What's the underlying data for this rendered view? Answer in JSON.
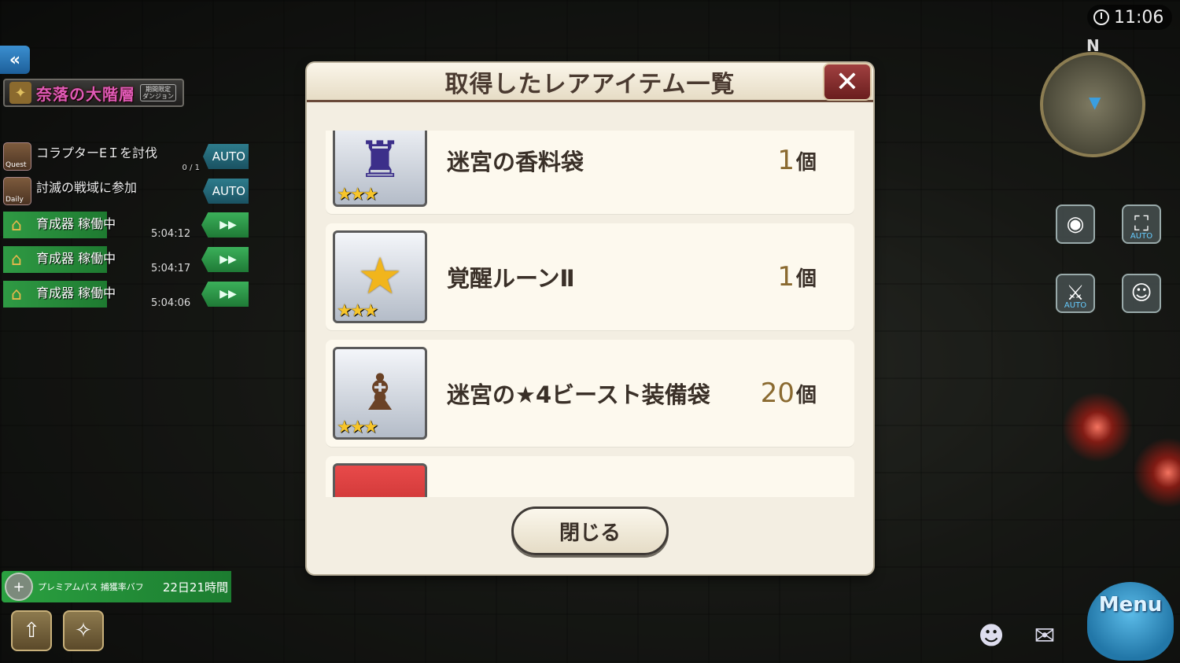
{
  "hud": {
    "clock": "11:06",
    "compass": "N",
    "dungeon": {
      "name": "奈落の大階層",
      "badge_line1": "期間限定",
      "badge_line2": "ダンジョン"
    },
    "quests": [
      {
        "tag": "Quest",
        "text": "コラプターEＩを討伐",
        "progress": "0 / 1",
        "button": "AUTO"
      },
      {
        "tag": "Daily",
        "text": "討滅の戦域に参加",
        "progress": "",
        "button": "AUTO"
      }
    ],
    "incubators": [
      {
        "label": "育成器 稼働中",
        "time": "5:04:12"
      },
      {
        "label": "育成器 稼働中",
        "time": "5:04:17"
      },
      {
        "label": "育成器 稼働中",
        "time": "5:04:06"
      }
    ],
    "premium": {
      "label": "プレミアムパス 捕獲率バフ",
      "time": "22日21時間"
    },
    "side_buttons": {
      "auto_label_1": "AUTO",
      "auto_label_2": "AUTO"
    },
    "menu_label": "Menu"
  },
  "modal": {
    "title": "取得したレアアイテム一覧",
    "close_label": "閉じる",
    "items": [
      {
        "name": "迷宮の香料袋",
        "count": "1",
        "unit": "個",
        "stars": "★★★",
        "icon": "pouch-icon"
      },
      {
        "name": "覚醒ルーンⅡ",
        "count": "1",
        "unit": "個",
        "stars": "★★★",
        "icon": "star-rune-icon"
      },
      {
        "name": "迷宮の★4ビースト装備袋",
        "count": "20",
        "unit": "個",
        "stars": "★★★",
        "icon": "equipment-bag-icon"
      },
      {
        "name": "",
        "count": "",
        "unit": "",
        "stars": "",
        "icon": "red-star-icon"
      }
    ]
  },
  "colors": {
    "modal_bg": "#f3eee2",
    "header_border": "#6a4a3a",
    "close_x": "#8a2a2a",
    "hud_green": "#2aa040",
    "auto_teal": "#2e7c8c",
    "count_gold": "#8a6a30"
  }
}
